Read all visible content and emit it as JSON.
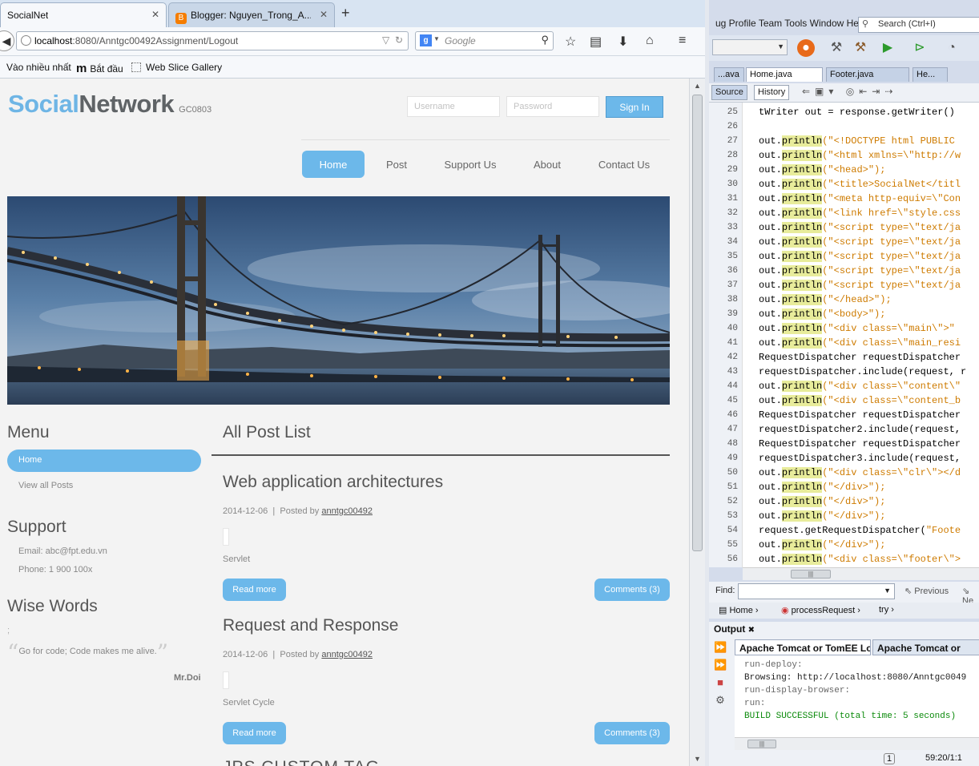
{
  "browser": {
    "tabs": [
      {
        "title": "SocialNet",
        "close": "✕"
      },
      {
        "title": "Blogger: Nguyen_Trong_A...",
        "close": "✕"
      }
    ],
    "new_tab": "+",
    "url_host": "localhost",
    "url_rest": ":8080/Anntgc00492Assignment/Logout",
    "search_placeholder": "Google",
    "bookmarks": [
      "Vào nhiều nhất",
      "Bắt đầu",
      "Web Slice Gallery"
    ]
  },
  "site": {
    "logo_social": "Social",
    "logo_network": "Network",
    "logo_code": "GC0803",
    "username_placeholder": "Username",
    "password_placeholder": "Password",
    "signin": "Sign In",
    "nav": [
      "Home",
      "Post",
      "Support Us",
      "About",
      "Contact Us"
    ],
    "sidebar": {
      "menu_heading": "Menu",
      "menu_home": "Home",
      "menu_view_all": "View all Posts",
      "support_heading": "Support",
      "email": "Email: abc@fpt.edu.vn",
      "phone": "Phone: 1 900 100x",
      "wise_heading": "Wise Words",
      "semicolon": ";",
      "quote": "Go for code; Code makes me alive.",
      "quote_author": "Mr.Doi"
    },
    "main_heading": "All Post List",
    "posts": [
      {
        "title": "Web application architectures",
        "date": "2014-12-06",
        "posted_by": "Posted by",
        "author": "anntgc00492",
        "body": "Servlet",
        "read_more": "Read more",
        "comments": "Comments (3)"
      },
      {
        "title": "Request and Response",
        "date": "2014-12-06",
        "posted_by": "Posted by",
        "author": "anntgc00492",
        "body": "Servlet Cycle",
        "read_more": "Read more",
        "comments": "Comments (3)"
      }
    ],
    "partial_title": "JPS CUSTOM TAG"
  },
  "ide": {
    "menu": "ug Profile Team Tools Window Help",
    "search_placeholder": "Search (Ctrl+I)",
    "tabs": [
      "...ava",
      "Home.java",
      "Footer.java",
      "He..."
    ],
    "source": "Source",
    "history": "History",
    "lines": [
      {
        "n": "25",
        "pre": "tWriter out = response.getWriter()",
        "k": "",
        "s": ""
      },
      {
        "n": "26",
        "pre": "",
        "k": "",
        "s": ""
      },
      {
        "n": "27",
        "pre": "out.",
        "k": "println",
        "s": "(\"<!DOCTYPE html PUBLIC"
      },
      {
        "n": "28",
        "pre": "out.",
        "k": "println",
        "s": "(\"<html xmlns=\\\"http://w"
      },
      {
        "n": "29",
        "pre": "out.",
        "k": "println",
        "s": "(\"<head>\");"
      },
      {
        "n": "30",
        "pre": "out.",
        "k": "println",
        "s": "(\"<title>SocialNet</titl"
      },
      {
        "n": "31",
        "pre": "out.",
        "k": "println",
        "s": "(\"<meta http-equiv=\\\"Con"
      },
      {
        "n": "32",
        "pre": "out.",
        "k": "println",
        "s": "(\"<link href=\\\"style.css"
      },
      {
        "n": "33",
        "pre": "out.",
        "k": "println",
        "s": "(\"<script type=\\\"text/ja"
      },
      {
        "n": "34",
        "pre": "out.",
        "k": "println",
        "s": "(\"<script type=\\\"text/ja"
      },
      {
        "n": "35",
        "pre": "out.",
        "k": "println",
        "s": "(\"<script type=\\\"text/ja"
      },
      {
        "n": "36",
        "pre": "out.",
        "k": "println",
        "s": "(\"<script type=\\\"text/ja"
      },
      {
        "n": "37",
        "pre": "out.",
        "k": "println",
        "s": "(\"<script type=\\\"text/ja"
      },
      {
        "n": "38",
        "pre": "out.",
        "k": "println",
        "s": "(\"</head>\");"
      },
      {
        "n": "39",
        "pre": "out.",
        "k": "println",
        "s": "(\"<body>\");"
      },
      {
        "n": "40",
        "pre": "out.",
        "k": "println",
        "s": "(\"<div class=\\\"main\\\">\""
      },
      {
        "n": "41",
        "pre": "out.",
        "k": "println",
        "s": "(\"<div class=\\\"main_resi"
      },
      {
        "n": "42",
        "pre": "RequestDispatcher requestDispatcher",
        "k": "",
        "s": ""
      },
      {
        "n": "43",
        "pre": "requestDispatcher.include(request, r",
        "k": "",
        "s": ""
      },
      {
        "n": "44",
        "pre": "out.",
        "k": "println",
        "s": "(\"<div class=\\\"content\\\""
      },
      {
        "n": "45",
        "pre": "out.",
        "k": "println",
        "s": "(\"<div class=\\\"content_b"
      },
      {
        "n": "46",
        "pre": "RequestDispatcher requestDispatcher",
        "k": "",
        "s": ""
      },
      {
        "n": "47",
        "pre": "requestDispatcher2.include(request,",
        "k": "",
        "s": ""
      },
      {
        "n": "48",
        "pre": "RequestDispatcher requestDispatcher",
        "k": "",
        "s": ""
      },
      {
        "n": "49",
        "pre": "requestDispatcher3.include(request,",
        "k": "",
        "s": ""
      },
      {
        "n": "50",
        "pre": "out.",
        "k": "println",
        "s": "(\"<div class=\\\"clr\\\"></d"
      },
      {
        "n": "51",
        "pre": "out.",
        "k": "println",
        "s": "(\"</div>\");"
      },
      {
        "n": "52",
        "pre": "out.",
        "k": "println",
        "s": "(\"</div>\");"
      },
      {
        "n": "53",
        "pre": "out.",
        "k": "println",
        "s": "(\"</div>\");"
      },
      {
        "n": "54",
        "pre": "request.getRequestDispatcher(",
        "k": "",
        "s": "\"Foote"
      },
      {
        "n": "55",
        "pre": "out.",
        "k": "println",
        "s": "(\"</div>\");"
      },
      {
        "n": "56",
        "pre": "out.",
        "k": "println",
        "s": "(\"<div class=\\\"footer\\\">"
      }
    ],
    "find_label": "Find:",
    "find_prev": "Previous",
    "find_next": "Ne",
    "crumbs": [
      "Home",
      "processRequest",
      "try"
    ],
    "output_label": "Output",
    "output_tabs": [
      "Apache Tomcat or TomEE Log",
      "Apache Tomcat or"
    ],
    "output_lines": [
      {
        "text": "run-deploy:",
        "cls": "g"
      },
      {
        "text": "Browsing: http://localhost:8080/Anntgc0049",
        "cls": ""
      },
      {
        "text": "run-display-browser:",
        "cls": "g"
      },
      {
        "text": "run:",
        "cls": "g"
      },
      {
        "text": "BUILD SUCCESSFUL (total time: 5 seconds)",
        "cls": "ok"
      }
    ],
    "status_num": "1",
    "status_pos": "59:20/1:1"
  }
}
